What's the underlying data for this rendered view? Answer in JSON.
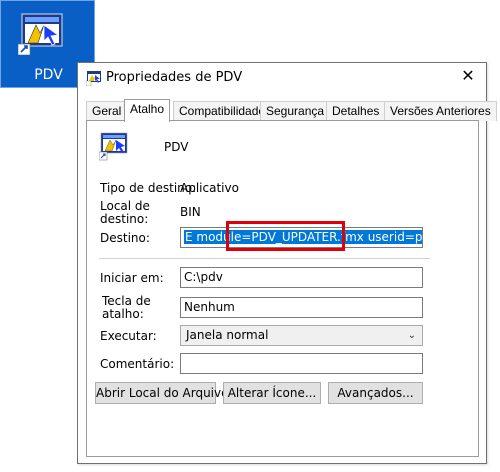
{
  "desktop_icon": {
    "label": "PDV"
  },
  "dialog": {
    "title": "Propriedades de PDV",
    "close_glyph": "✕",
    "tabs": [
      {
        "label": "Geral"
      },
      {
        "label": "Atalho"
      },
      {
        "label": "Compatibilidade"
      },
      {
        "label": "Segurança"
      },
      {
        "label": "Detalhes"
      },
      {
        "label": "Versões Anteriores"
      }
    ],
    "active_tab": "Atalho",
    "shortcut_name": "PDV",
    "fields": {
      "target_type": {
        "label": "Tipo de destino:",
        "value": "Aplicativo"
      },
      "target_location": {
        "label_line1": "Local de",
        "label_line2": "destino:",
        "value": "BIN"
      },
      "target": {
        "label": "Destino:",
        "value": "E module=PDV_UPDATER.fmx userid=pdv/pdv@xe"
      },
      "start_in": {
        "label": "Iniciar em:",
        "value": "C:\\pdv"
      },
      "hotkey": {
        "label_line1": "Tecla de",
        "label_line2": "atalho:",
        "value": "Nenhum"
      },
      "run": {
        "label": "Executar:",
        "value": "Janela normal"
      },
      "comment": {
        "label": "Comentário:",
        "value": ""
      }
    },
    "buttons": {
      "open_location": "Abrir Local do Arquivo",
      "change_icon": "Alterar Ícone...",
      "advanced": "Avançados..."
    }
  },
  "colors": {
    "desktop_blue": "#0a5fc6",
    "selection_blue": "#0078d7",
    "highlight_red": "#e0000a"
  },
  "icons": [
    "app-shortcut-icon",
    "shortcut-arrow-icon",
    "close-icon",
    "chevron-down-icon"
  ]
}
